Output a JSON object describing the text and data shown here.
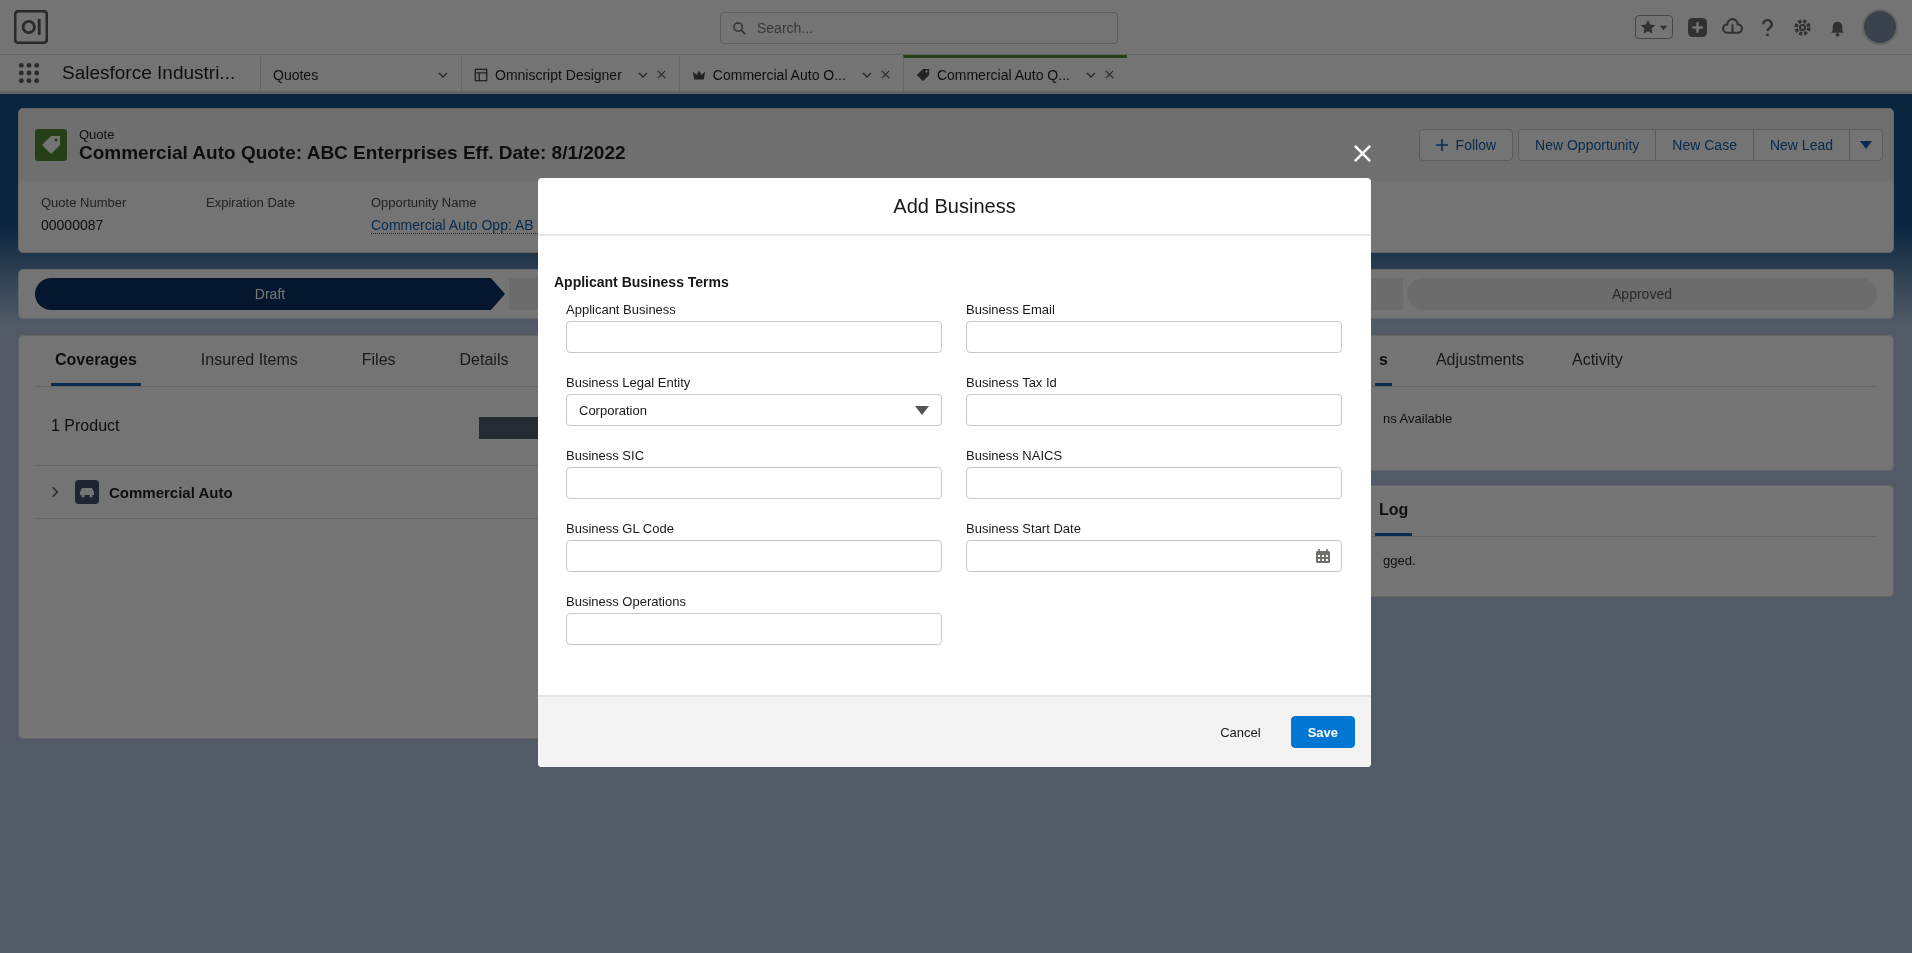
{
  "global_header": {
    "search": {
      "placeholder": "Search..."
    }
  },
  "nav": {
    "app_name": "Salesforce Industri...",
    "tabs": [
      {
        "label": "Quotes",
        "kind": "object",
        "selected": false
      },
      {
        "label": "Omniscript Designer",
        "kind": "designer",
        "selected": false
      },
      {
        "label": "Commercial Auto O...",
        "kind": "opportunity",
        "selected": false
      },
      {
        "label": "Commercial Auto Q...",
        "kind": "quote",
        "selected": true
      }
    ]
  },
  "record": {
    "object_label": "Quote",
    "title": "Commercial Auto Quote: ABC Enterprises Eff. Date: 8/1/2022",
    "actions": [
      {
        "label": "Follow",
        "kind": "follow"
      },
      {
        "label": "New Opportunity",
        "kind": "action"
      },
      {
        "label": "New Case",
        "kind": "action"
      },
      {
        "label": "New Lead",
        "kind": "action"
      },
      {
        "kind": "menu"
      }
    ],
    "fields": [
      {
        "label": "Quote Number",
        "value": "00000087",
        "kind": "text"
      },
      {
        "label": "Expiration Date",
        "kind": "text"
      },
      {
        "label": "Opportunity Name",
        "value": "Commercial Auto Opp: AB",
        "kind": "link"
      }
    ]
  },
  "path": [
    {
      "label": "Draft",
      "selected": true
    },
    {
      "label": "Approved",
      "selected": false
    }
  ],
  "left_panel": {
    "tabs": [
      {
        "label": "Coverages",
        "selected": true
      },
      {
        "label": "Insured Items",
        "selected": false
      },
      {
        "label": "Files",
        "selected": false
      },
      {
        "label": "Details",
        "selected": false
      }
    ],
    "count": "1 Product",
    "products": [
      {
        "name": "Commercial Auto",
        "expanded": false
      }
    ]
  },
  "right_panel": {
    "tabs": [
      {
        "label": "s",
        "selected": true
      },
      {
        "label": "Adjustments",
        "selected": false
      },
      {
        "label": "Activity",
        "selected": false
      }
    ],
    "message": "ns Available"
  },
  "log_panel": {
    "tabs": [
      {
        "label": "Log",
        "selected": true
      }
    ],
    "message": "gged."
  },
  "modal": {
    "title": "Add Business",
    "section": "Applicant Business Terms",
    "fields": [
      {
        "label": "Applicant Business",
        "kind": "text"
      },
      {
        "label": "Business Email",
        "kind": "text"
      },
      {
        "label": "Business Legal Entity",
        "kind": "select",
        "value": "Corporation"
      },
      {
        "label": "Business Tax Id",
        "kind": "text"
      },
      {
        "label": "Business SIC",
        "kind": "text"
      },
      {
        "label": "Business NAICS",
        "kind": "text"
      },
      {
        "label": "Business GL Code",
        "kind": "text"
      },
      {
        "label": "Business Start Date",
        "kind": "date"
      },
      {
        "label": "Business Operations",
        "kind": "text"
      }
    ],
    "buttons": [
      {
        "label": "Cancel",
        "kind": "neutral"
      },
      {
        "label": "Save",
        "kind": "brand"
      }
    ]
  }
}
